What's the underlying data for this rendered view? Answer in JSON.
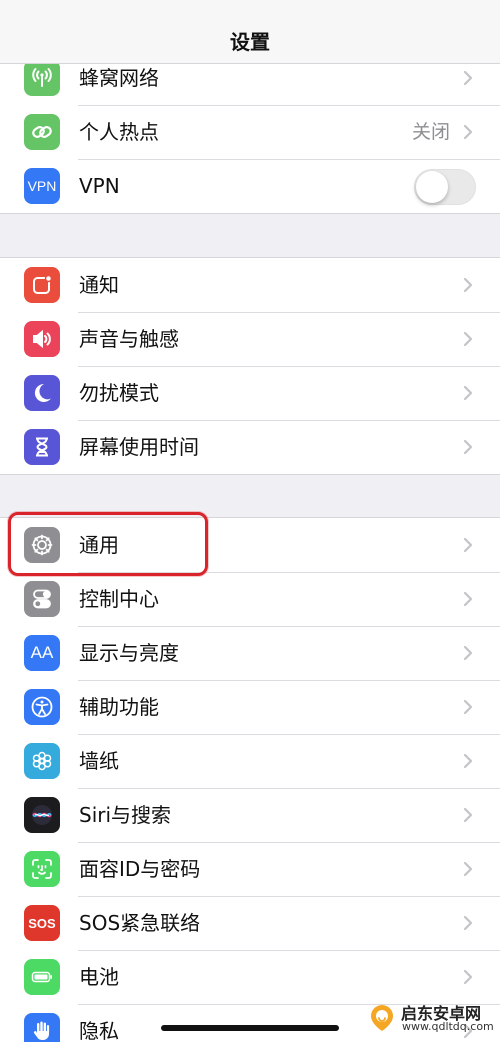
{
  "header": {
    "title": "设置"
  },
  "groups": [
    {
      "rows": [
        {
          "label": "蜂窝网络",
          "icon": "antenna-icon",
          "color": "#65c466",
          "accessory": "chevron"
        },
        {
          "label": "个人热点",
          "icon": "link-icon",
          "color": "#65c466",
          "value": "关闭",
          "accessory": "chevron"
        },
        {
          "label": "VPN",
          "icon": "vpn-icon",
          "color": "#3478f6",
          "icon_text": "VPN",
          "accessory": "toggle",
          "toggle_on": false
        }
      ]
    },
    {
      "rows": [
        {
          "label": "通知",
          "icon": "notification-icon",
          "color": "#eb4d3d",
          "accessory": "chevron"
        },
        {
          "label": "声音与触感",
          "icon": "speaker-icon",
          "color": "#eb445a",
          "accessory": "chevron"
        },
        {
          "label": "勿扰模式",
          "icon": "moon-icon",
          "color": "#5856d6",
          "accessory": "chevron"
        },
        {
          "label": "屏幕使用时间",
          "icon": "hourglass-icon",
          "color": "#5856d6",
          "accessory": "chevron"
        }
      ]
    },
    {
      "rows": [
        {
          "label": "通用",
          "icon": "gear-icon",
          "color": "#8e8e93",
          "accessory": "chevron",
          "highlighted": true
        },
        {
          "label": "控制中心",
          "icon": "switches-icon",
          "color": "#8e8e93",
          "accessory": "chevron"
        },
        {
          "label": "显示与亮度",
          "icon": "text-size-icon",
          "color": "#3478f6",
          "icon_text": "AA",
          "accessory": "chevron"
        },
        {
          "label": "辅助功能",
          "icon": "accessibility-icon",
          "color": "#3478f6",
          "accessory": "chevron"
        },
        {
          "label": "墙纸",
          "icon": "flower-icon",
          "color": "#35aadc",
          "accessory": "chevron"
        },
        {
          "label": "Siri与搜索",
          "icon": "siri-icon",
          "color": "#1c1c1e",
          "accessory": "chevron"
        },
        {
          "label": "面容ID与密码",
          "icon": "face-id-icon",
          "color": "#4cd964",
          "accessory": "chevron"
        },
        {
          "label": "SOS紧急联络",
          "icon": "sos-icon",
          "color": "#e0372c",
          "icon_text": "SOS",
          "accessory": "chevron"
        },
        {
          "label": "电池",
          "icon": "battery-icon",
          "color": "#4cd964",
          "accessory": "chevron"
        },
        {
          "label": "隐私",
          "icon": "hand-icon",
          "color": "#3478f6",
          "accessory": "chevron"
        }
      ]
    }
  ],
  "watermark": {
    "name": "启东安卓网",
    "url": "www.qdltdq.com"
  }
}
